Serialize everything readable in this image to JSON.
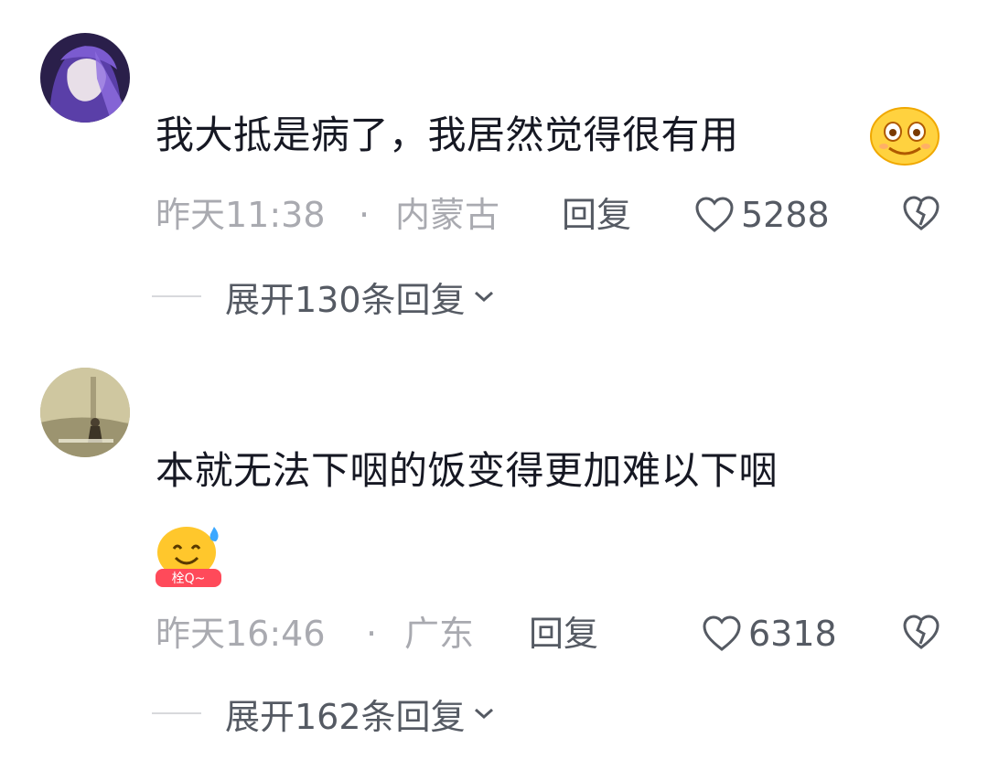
{
  "comments": [
    {
      "text": "我大抵是病了，我居然觉得很有用",
      "emoji": "smiling-face-emoji",
      "time": "昨天11:38",
      "separator": "·",
      "location": "内蒙古",
      "reply_label": "回复",
      "likes": "5288",
      "expand_label": "展开130条回复"
    },
    {
      "text": "本就无法下咽的饭变得更加难以下咽",
      "emoji": "sweat-smile-emoji",
      "emoji_caption": "栓Q~",
      "time": "昨天16:46",
      "separator": "·",
      "location": "广东",
      "reply_label": "回复",
      "likes": "6318",
      "expand_label": "展开162条回复"
    }
  ],
  "colors": {
    "text": "#161823",
    "meta": "#a9aab0",
    "action": "#555a63"
  }
}
